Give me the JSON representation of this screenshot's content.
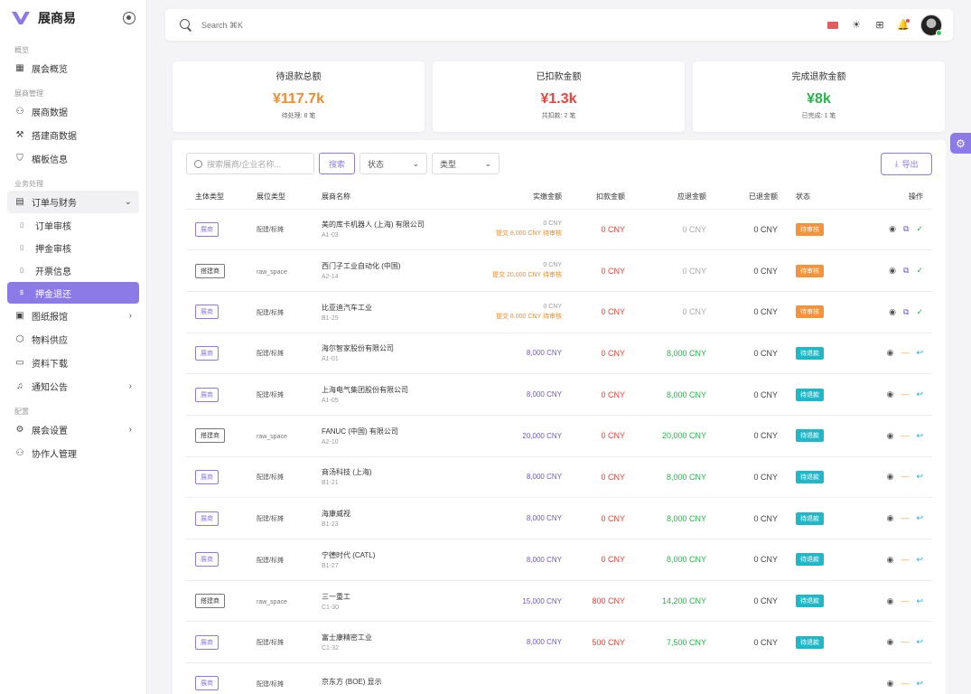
{
  "brand": {
    "name": "展商易"
  },
  "sidebar": {
    "groups": [
      {
        "label": "概览",
        "items": [
          {
            "label": "展会概览",
            "icon": "dashboard-icon"
          }
        ]
      },
      {
        "label": "展商管理",
        "items": [
          {
            "label": "展商数据",
            "icon": "users-icon"
          },
          {
            "label": "搭建商数据",
            "icon": "hammer-icon"
          },
          {
            "label": "楣板信息",
            "icon": "shield-icon"
          }
        ]
      },
      {
        "label": "业务处理",
        "items": [
          {
            "label": "订单与财务",
            "icon": "file-list-icon",
            "expanded": true
          },
          {
            "label": "订单审核",
            "sub": true
          },
          {
            "label": "押金审核",
            "sub": true
          },
          {
            "label": "开票信息",
            "sub": true
          },
          {
            "label": "押金退还",
            "sub": true,
            "active": true
          },
          {
            "label": "图纸报馆",
            "icon": "image-icon",
            "chevron": true
          },
          {
            "label": "物料供应",
            "icon": "box-icon"
          },
          {
            "label": "资料下载",
            "icon": "folder-icon"
          },
          {
            "label": "通知公告",
            "icon": "bell-icon",
            "chevron": true
          }
        ]
      },
      {
        "label": "配置",
        "items": [
          {
            "label": "展会设置",
            "icon": "gear-icon",
            "chevron": true
          },
          {
            "label": "协作人管理",
            "icon": "people-icon"
          }
        ]
      }
    ]
  },
  "topbar": {
    "search_placeholder": "Search ⌘K"
  },
  "stats": [
    {
      "title": "待退款总额",
      "value": "¥117.7k",
      "sub": "待处理: 8 笔",
      "color": "#f08c2a"
    },
    {
      "title": "已扣款金额",
      "value": "¥1.3k",
      "sub": "共扣款: 2 笔",
      "color": "#e8453c"
    },
    {
      "title": "完成退款金额",
      "value": "¥8k",
      "sub": "已完成: 1 笔",
      "color": "#2bb24c"
    }
  ],
  "filters": {
    "search_placeholder": "搜索展商/企业名称...",
    "search_button": "搜索",
    "status_select": "状态",
    "type_select": "类型",
    "export_button": "导出"
  },
  "table": {
    "headers": [
      "主体类型",
      "展位类型",
      "展商名称",
      "实缴金额",
      "扣款金额",
      "应退金额",
      "已退金额",
      "状态",
      "操作"
    ],
    "rows": [
      {
        "type": "展商",
        "booth": "配建/标摊",
        "name": "美的库卡机器人 (上海) 有限公司",
        "code": "A1-03",
        "paid": "0 CNY",
        "paid_note": "提交 8,000 CNY 待审核",
        "deduct": "0 CNY",
        "refundable": "0 CNY",
        "refunded": "0 CNY",
        "status": "待审核"
      },
      {
        "type": "搭建商",
        "booth": "raw_space",
        "name": "西门子工业自动化 (中国)",
        "code": "A2-14",
        "paid": "0 CNY",
        "paid_note": "提交 20,000 CNY 待审核",
        "deduct": "0 CNY",
        "refundable": "0 CNY",
        "refunded": "0 CNY",
        "status": "待审核"
      },
      {
        "type": "展商",
        "booth": "配建/标摊",
        "name": "比亚迪汽车工业",
        "code": "B1-25",
        "paid": "0 CNY",
        "paid_note": "提交 8,000 CNY 待审核",
        "deduct": "0 CNY",
        "refundable": "0 CNY",
        "refunded": "0 CNY",
        "status": "待审核"
      },
      {
        "type": "展商",
        "booth": "配建/标摊",
        "name": "海尔智家股份有限公司",
        "code": "A1-01",
        "paid": "8,000 CNY",
        "paid_note": "",
        "deduct": "0 CNY",
        "refundable": "8,000 CNY",
        "refunded": "0 CNY",
        "status": "待退款"
      },
      {
        "type": "展商",
        "booth": "配建/标摊",
        "name": "上海电气集团股份有限公司",
        "code": "A1-05",
        "paid": "8,000 CNY",
        "paid_note": "",
        "deduct": "0 CNY",
        "refundable": "8,000 CNY",
        "refunded": "0 CNY",
        "status": "待退款"
      },
      {
        "type": "搭建商",
        "booth": "raw_space",
        "name": "FANUC (中国) 有限公司",
        "code": "A2-10",
        "paid": "20,000 CNY",
        "paid_note": "",
        "deduct": "0 CNY",
        "refundable": "20,000 CNY",
        "refunded": "0 CNY",
        "status": "待退款"
      },
      {
        "type": "展商",
        "booth": "配建/标摊",
        "name": "商汤科技 (上海)",
        "code": "B1-21",
        "paid": "8,000 CNY",
        "paid_note": "",
        "deduct": "0 CNY",
        "refundable": "8,000 CNY",
        "refunded": "0 CNY",
        "status": "待退款"
      },
      {
        "type": "展商",
        "booth": "配建/标摊",
        "name": "海康威视",
        "code": "B1-23",
        "paid": "8,000 CNY",
        "paid_note": "",
        "deduct": "0 CNY",
        "refundable": "8,000 CNY",
        "refunded": "0 CNY",
        "status": "待退款"
      },
      {
        "type": "展商",
        "booth": "配建/标摊",
        "name": "宁德时代 (CATL)",
        "code": "B1-27",
        "paid": "8,000 CNY",
        "paid_note": "",
        "deduct": "0 CNY",
        "refundable": "8,000 CNY",
        "refunded": "0 CNY",
        "status": "待退款"
      },
      {
        "type": "搭建商",
        "booth": "raw_space",
        "name": "三一重工",
        "code": "C1-30",
        "paid": "15,000 CNY",
        "paid_note": "",
        "deduct": "800 CNY",
        "refundable": "14,200 CNY",
        "refunded": "0 CNY",
        "status": "待退款"
      },
      {
        "type": "展商",
        "booth": "配建/标摊",
        "name": "富士康精密工业",
        "code": "C1-32",
        "paid": "8,000 CNY",
        "paid_note": "",
        "deduct": "500 CNY",
        "refundable": "7,500 CNY",
        "refunded": "0 CNY",
        "status": "待退款"
      },
      {
        "type": "展商",
        "booth": "配建/标摊",
        "name": "京东方 (BOE) 显示",
        "code": "",
        "paid": "",
        "paid_note": "",
        "deduct": "",
        "refundable": "",
        "refunded": "",
        "status": ""
      }
    ]
  },
  "colors": {
    "accent": "#8c7ae6",
    "pending_review": "#f5923a",
    "pending_refund": "#1fb8c9",
    "deduct": "#e8453c",
    "refund": "#2bb24c"
  }
}
